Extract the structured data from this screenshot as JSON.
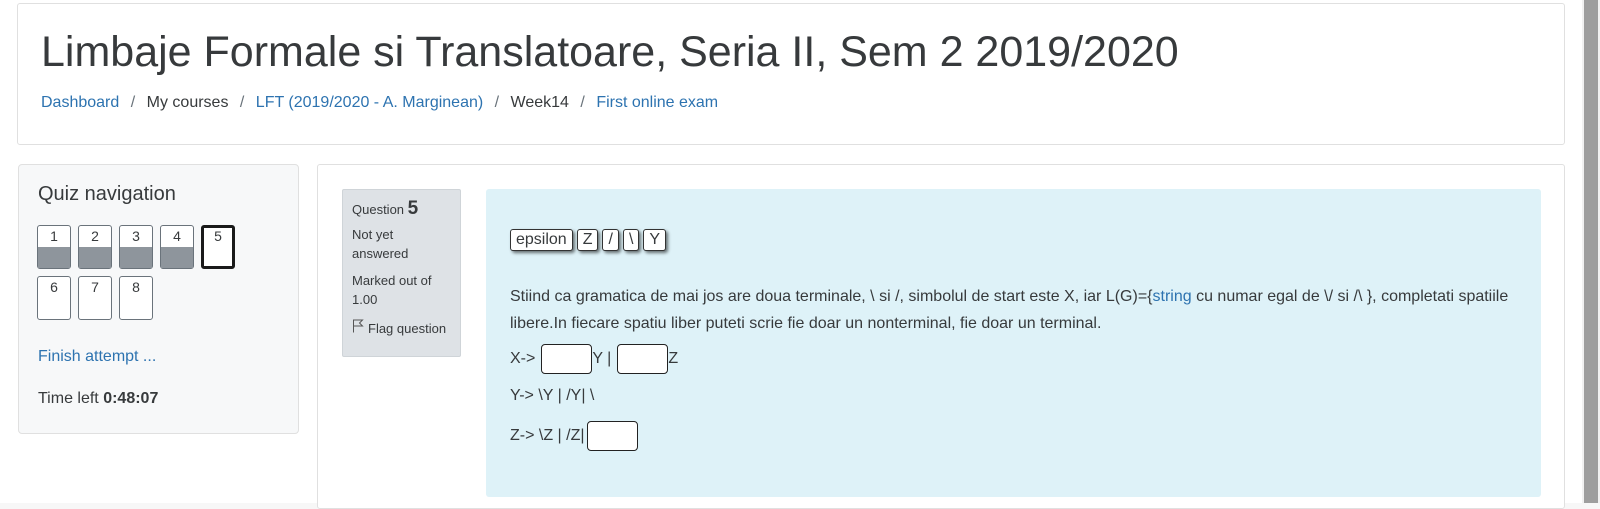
{
  "header": {
    "title": "Limbaje Formale si Translatoare, Seria II, Sem 2 2019/2020",
    "breadcrumb": {
      "dashboard": "Dashboard",
      "my_courses": "My courses",
      "course": "LFT (2019/2020 - A. Marginean)",
      "week": "Week14",
      "quiz": "First online exam",
      "separator": "/"
    }
  },
  "quiz_nav": {
    "title": "Quiz navigation",
    "questions": [
      {
        "label": "1",
        "state": "answered"
      },
      {
        "label": "2",
        "state": "answered"
      },
      {
        "label": "3",
        "state": "answered"
      },
      {
        "label": "4",
        "state": "answered"
      },
      {
        "label": "5",
        "state": "current"
      },
      {
        "label": "6",
        "state": "not-answered"
      },
      {
        "label": "7",
        "state": "not-answered"
      },
      {
        "label": "8",
        "state": "not-answered"
      }
    ],
    "finish_label": "Finish attempt ...",
    "time_left_label": "Time left",
    "time_left_value": "0:48:07"
  },
  "question": {
    "prefix": "Question",
    "number": "5",
    "state": "Not yet answered",
    "grade": "Marked out of 1.00",
    "flag_label": "Flag question",
    "tokens": [
      "epsilon",
      "Z",
      "/",
      "\\",
      "Y"
    ],
    "text_part1": "Stiind ca gramatica de mai jos are doua terminale, \\ si /, simbolul de start este X, iar L(G)={",
    "text_link": "string",
    "text_part2": " cu numar egal de \\/ si /\\ }, completati spatiile libere.In fiecare spatiu liber puteti scrie fie doar un nonterminal, fie doar un terminal.",
    "rule1_prefix": "X-> ",
    "rule1_mid": "Y | ",
    "rule1_end": "Z",
    "rule2": "Y-> \\Y | /Y| \\",
    "rule3_prefix": "Z-> \\Z | /Z|"
  },
  "colors": {
    "link": "#2d73b0",
    "question_bg": "#def2f8",
    "answered_fill": "#8e959c"
  }
}
